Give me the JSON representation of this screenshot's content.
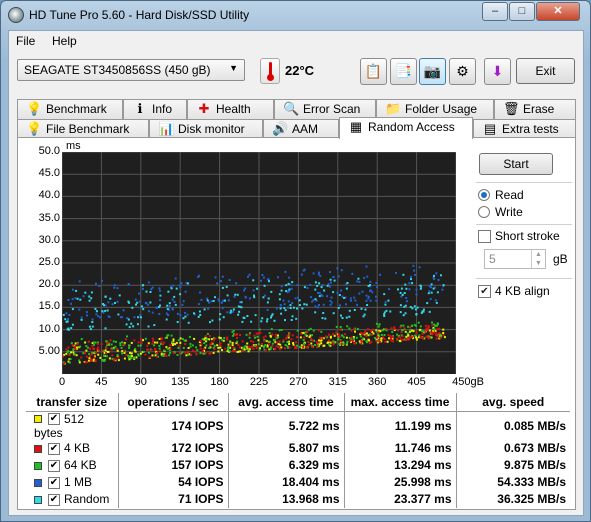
{
  "window": {
    "title": "HD Tune Pro 5.60 - Hard Disk/SSD Utility"
  },
  "menu": [
    "File",
    "Help"
  ],
  "toolbar": {
    "drive": "SEAGATE ST3450856SS (450 gB)",
    "temperature": "22°C",
    "exit_label": "Exit",
    "buttons": [
      {
        "icon": "copy-text-icon",
        "glyph": "📋"
      },
      {
        "icon": "copy-info-icon",
        "glyph": "📑"
      },
      {
        "icon": "screenshot-camera-icon",
        "glyph": "📷"
      },
      {
        "icon": "options-icon",
        "glyph": "⚙"
      },
      {
        "icon": "save-arrow-icon",
        "glyph": "⬇"
      }
    ]
  },
  "tabs_row1": [
    {
      "name": "tab-benchmark",
      "label": "Benchmark",
      "icon": "benchmark-icon",
      "glyph": "💡"
    },
    {
      "name": "tab-info",
      "label": "Info",
      "icon": "info-icon",
      "glyph": "ℹ"
    },
    {
      "name": "tab-health",
      "label": "Health",
      "icon": "health-cross-icon",
      "glyph": "✚"
    },
    {
      "name": "tab-error-scan",
      "label": "Error Scan",
      "icon": "magnifier-icon",
      "glyph": "🔍"
    },
    {
      "name": "tab-folder-usage",
      "label": "Folder Usage",
      "icon": "folder-icon",
      "glyph": "📁"
    },
    {
      "name": "tab-erase",
      "label": "Erase",
      "icon": "trash-icon",
      "glyph": "🗑"
    }
  ],
  "tabs_row2": [
    {
      "name": "tab-file-benchmark",
      "label": "File Benchmark",
      "icon": "file-benchmark-icon",
      "glyph": "💡"
    },
    {
      "name": "tab-disk-monitor",
      "label": "Disk monitor",
      "icon": "monitor-chart-icon",
      "glyph": "📊"
    },
    {
      "name": "tab-aam",
      "label": "AAM",
      "icon": "speaker-icon",
      "glyph": "🔊"
    },
    {
      "name": "tab-random-access",
      "label": "Random Access",
      "icon": "random-access-icon",
      "glyph": "▦"
    },
    {
      "name": "tab-extra-tests",
      "label": "Extra tests",
      "icon": "extra-tests-icon",
      "glyph": "▤"
    }
  ],
  "selected_tab": "Random Access",
  "controls": {
    "start_label": "Start",
    "read_label": "Read",
    "write_label": "Write",
    "mode": "Read",
    "short_stroke_label": "Short stroke",
    "short_stroke_checked": false,
    "stroke_value": "5",
    "stroke_unit": "gB",
    "align_label": "4 KB align",
    "align_checked": true
  },
  "colors": {
    "512": "#f0f000",
    "4k": "#e01010",
    "64k": "#20c020",
    "1m": "#2060d0",
    "random": "#30d8e8"
  },
  "chart_data": {
    "type": "scatter",
    "ylabel": "ms",
    "xlabel": "gB",
    "xlim": [
      0,
      450
    ],
    "ylim": [
      0,
      50
    ],
    "yticks": [
      "50.0",
      "45.0",
      "40.0",
      "35.0",
      "30.0",
      "25.0",
      "20.0",
      "15.0",
      "10.0",
      "5.00"
    ],
    "xticks": [
      "0",
      "45",
      "90",
      "135",
      "180",
      "225",
      "270",
      "315",
      "360",
      "405",
      "450gB"
    ],
    "grid": true,
    "series": [
      {
        "name": "512 bytes",
        "color": "#f0f000",
        "low_start": 2.5,
        "low_end": 8.5,
        "high_start": 7.5,
        "high_end": 11.0
      },
      {
        "name": "4 KB",
        "color": "#e01010",
        "low_start": 2.5,
        "low_end": 8.5,
        "high_start": 7.5,
        "high_end": 11.5
      },
      {
        "name": "64 KB",
        "color": "#20c020",
        "low_start": 2.5,
        "low_end": 8.8,
        "high_start": 8.0,
        "high_end": 12.5
      },
      {
        "name": "1 MB",
        "color": "#2060d0",
        "low_start": 12.0,
        "low_end": 17.0,
        "high_start": 21.0,
        "high_end": 25.5
      },
      {
        "name": "Random",
        "color": "#30d8e8",
        "low_start": 10.0,
        "low_end": 14.0,
        "high_start": 20.0,
        "high_end": 23.0
      }
    ]
  },
  "results": {
    "headers": [
      "transfer size",
      "operations / sec",
      "avg. access time",
      "max. access time",
      "avg. speed"
    ],
    "rows": [
      {
        "label": "512 bytes",
        "iops": "174 IOPS",
        "avg": "5.722 ms",
        "max": "11.199 ms",
        "speed": "0.085 MB/s",
        "color": "#f0f000"
      },
      {
        "label": "4 KB",
        "iops": "172 IOPS",
        "avg": "5.807 ms",
        "max": "11.746 ms",
        "speed": "0.673 MB/s",
        "color": "#e01010"
      },
      {
        "label": "64 KB",
        "iops": "157 IOPS",
        "avg": "6.329 ms",
        "max": "13.294 ms",
        "speed": "9.875 MB/s",
        "color": "#20c020"
      },
      {
        "label": "1 MB",
        "iops": "54 IOPS",
        "avg": "18.404 ms",
        "max": "25.998 ms",
        "speed": "54.333 MB/s",
        "color": "#2060d0"
      },
      {
        "label": "Random",
        "iops": "71 IOPS",
        "avg": "13.968 ms",
        "max": "23.377 ms",
        "speed": "36.325 MB/s",
        "color": "#30d8e8"
      }
    ]
  }
}
